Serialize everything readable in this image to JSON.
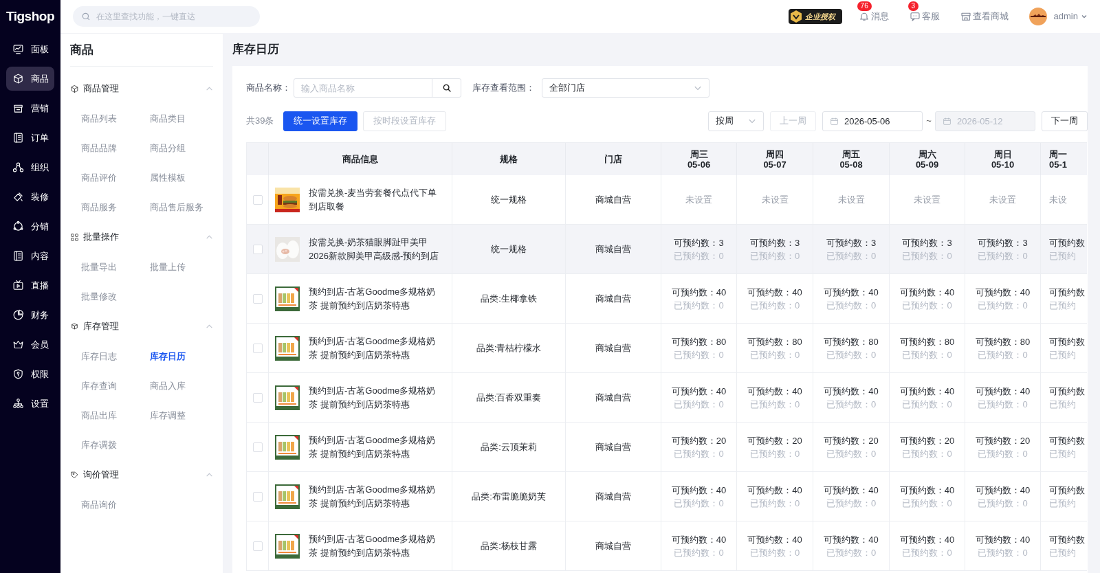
{
  "brand": "Tigshop",
  "nav": [
    {
      "label": "面板",
      "selected": false
    },
    {
      "label": "商品",
      "selected": true
    },
    {
      "label": "营销",
      "selected": false
    },
    {
      "label": "订单",
      "selected": false
    },
    {
      "label": "组织",
      "selected": false
    },
    {
      "label": "装修",
      "selected": false
    },
    {
      "label": "分销",
      "selected": false
    },
    {
      "label": "内容",
      "selected": false
    },
    {
      "label": "直播",
      "selected": false
    },
    {
      "label": "财务",
      "selected": false
    },
    {
      "label": "会员",
      "selected": false
    },
    {
      "label": "权限",
      "selected": false
    },
    {
      "label": "设置",
      "selected": false
    }
  ],
  "topbar": {
    "search": {
      "placeholder": "在这里查找功能，一键直达"
    },
    "license_badge": "企业授权",
    "actions": [
      {
        "label": "消息",
        "badge": "76"
      },
      {
        "label": "客服",
        "badge": "3"
      },
      {
        "label": "查看商城"
      }
    ],
    "user": "admin"
  },
  "sidebar": {
    "title": "商品",
    "groups": [
      {
        "title": "商品管理",
        "expanded": true,
        "items": [
          {
            "label": "商品列表",
            "selected": false
          },
          {
            "label": "商品类目",
            "selected": false
          },
          {
            "label": "商品品牌",
            "selected": false
          },
          {
            "label": "商品分组",
            "selected": false
          },
          {
            "label": "商品评价",
            "selected": false
          },
          {
            "label": "属性模板",
            "selected": false
          },
          {
            "label": "商品服务",
            "selected": false
          },
          {
            "label": "商品售后服务",
            "selected": false
          }
        ]
      },
      {
        "title": "批量操作",
        "expanded": true,
        "items": [
          {
            "label": "批量导出",
            "selected": false
          },
          {
            "label": "批量上传",
            "selected": false
          },
          {
            "label": "批量修改",
            "selected": false
          }
        ]
      },
      {
        "title": "库存管理",
        "expanded": true,
        "items": [
          {
            "label": "库存日志",
            "selected": false
          },
          {
            "label": "库存日历",
            "selected": true
          },
          {
            "label": "库存查询",
            "selected": false
          },
          {
            "label": "商品入库",
            "selected": false
          },
          {
            "label": "商品出库",
            "selected": false
          },
          {
            "label": "库存调整",
            "selected": false
          },
          {
            "label": "库存调拨",
            "selected": false
          }
        ]
      },
      {
        "title": "询价管理",
        "expanded": true,
        "items": [
          {
            "label": "商品询价",
            "selected": false
          }
        ]
      }
    ]
  },
  "page_title": "库存日历",
  "filters": {
    "name_label": "商品名称：",
    "name_placeholder": "输入商品名称",
    "scope_label": "库存查看范围：",
    "scope_value": "全部门店"
  },
  "toolbar": {
    "total": "共39条",
    "buttons": [
      {
        "label": "统一设置库存",
        "kind": "primary"
      },
      {
        "label": "按时段设置库存",
        "kind": "disabled"
      }
    ],
    "period": "按周",
    "prev": {
      "label": "上一周",
      "disabled": true
    },
    "start_date": "2026-05-06",
    "separator": "~",
    "end_date": {
      "value": "2026-05-12",
      "disabled": true
    },
    "next": {
      "label": "下一周",
      "disabled": false
    }
  },
  "table": {
    "columns": [
      "商品信息",
      "规格",
      "门店"
    ],
    "days": [
      {
        "weekday": "周三",
        "date": "05-06"
      },
      {
        "weekday": "周四",
        "date": "05-07"
      },
      {
        "weekday": "周五",
        "date": "05-08"
      },
      {
        "weekday": "周六",
        "date": "05-09"
      },
      {
        "weekday": "周日",
        "date": "05-10"
      },
      {
        "weekday": "周一",
        "date": "05-1"
      }
    ],
    "rows": [
      {
        "checked": false,
        "hovered": false,
        "name": "按需兑换-麦当劳套餐代点代下单到店取餐",
        "spec": "统一规格",
        "store": "商城自营",
        "cells": [
          {
            "kind": "unset",
            "text": "未设置"
          },
          {
            "kind": "unset",
            "text": "未设置"
          },
          {
            "kind": "unset",
            "text": "未设置"
          },
          {
            "kind": "unset",
            "text": "未设置"
          },
          {
            "kind": "unset",
            "text": "未设置"
          },
          {
            "kind": "unset",
            "text": "未设"
          }
        ]
      },
      {
        "checked": false,
        "hovered": true,
        "name": "按需兑换-奶茶猫眼脚趾甲美甲2026新款脚美甲高级感-预约到店",
        "spec": "统一规格",
        "store": "商城自营",
        "cells": [
          {
            "kind": "stock",
            "available": "可预约数：3",
            "booked": "已预约数：0"
          },
          {
            "kind": "stock",
            "available": "可预约数：3",
            "booked": "已预约数：0"
          },
          {
            "kind": "stock",
            "available": "可预约数：3",
            "booked": "已预约数：0"
          },
          {
            "kind": "stock",
            "available": "可预约数：3",
            "booked": "已预约数：0"
          },
          {
            "kind": "stock",
            "available": "可预约数：3",
            "booked": "已预约数：0"
          },
          {
            "kind": "stock",
            "available": "可预约数",
            "booked": "已预约"
          }
        ]
      },
      {
        "checked": false,
        "hovered": false,
        "name": "预约到店-古茗Goodme多规格奶茶 提前预约到店奶茶特惠",
        "spec": "品类:生椰拿铁",
        "store": "商城自营",
        "cells": [
          {
            "kind": "stock",
            "available": "可预约数：40",
            "booked": "已预约数：0"
          },
          {
            "kind": "stock",
            "available": "可预约数：40",
            "booked": "已预约数：0"
          },
          {
            "kind": "stock",
            "available": "可预约数：40",
            "booked": "已预约数：0"
          },
          {
            "kind": "stock",
            "available": "可预约数：40",
            "booked": "已预约数：0"
          },
          {
            "kind": "stock",
            "available": "可预约数：40",
            "booked": "已预约数：0"
          },
          {
            "kind": "stock",
            "available": "可预约数",
            "booked": "已预约"
          }
        ]
      },
      {
        "checked": false,
        "hovered": false,
        "name": "预约到店-古茗Goodme多规格奶茶 提前预约到店奶茶特惠",
        "spec": "品类:青桔柠檬水",
        "store": "商城自营",
        "cells": [
          {
            "kind": "stock",
            "available": "可预约数：80",
            "booked": "已预约数：0"
          },
          {
            "kind": "stock",
            "available": "可预约数：80",
            "booked": "已预约数：0"
          },
          {
            "kind": "stock",
            "available": "可预约数：80",
            "booked": "已预约数：0"
          },
          {
            "kind": "stock",
            "available": "可预约数：80",
            "booked": "已预约数：0"
          },
          {
            "kind": "stock",
            "available": "可预约数：80",
            "booked": "已预约数：0"
          },
          {
            "kind": "stock",
            "available": "可预约数",
            "booked": "已预约"
          }
        ]
      },
      {
        "checked": false,
        "hovered": false,
        "name": "预约到店-古茗Goodme多规格奶茶 提前预约到店奶茶特惠",
        "spec": "品类:百香双重奏",
        "store": "商城自营",
        "cells": [
          {
            "kind": "stock",
            "available": "可预约数：40",
            "booked": "已预约数：0"
          },
          {
            "kind": "stock",
            "available": "可预约数：40",
            "booked": "已预约数：0"
          },
          {
            "kind": "stock",
            "available": "可预约数：40",
            "booked": "已预约数：0"
          },
          {
            "kind": "stock",
            "available": "可预约数：40",
            "booked": "已预约数：0"
          },
          {
            "kind": "stock",
            "available": "可预约数：40",
            "booked": "已预约数：0"
          },
          {
            "kind": "stock",
            "available": "可预约数",
            "booked": "已预约"
          }
        ]
      },
      {
        "checked": false,
        "hovered": false,
        "name": "预约到店-古茗Goodme多规格奶茶 提前预约到店奶茶特惠",
        "spec": "品类:云顶茉莉",
        "store": "商城自营",
        "cells": [
          {
            "kind": "stock",
            "available": "可预约数：20",
            "booked": "已预约数：0"
          },
          {
            "kind": "stock",
            "available": "可预约数：20",
            "booked": "已预约数：0"
          },
          {
            "kind": "stock",
            "available": "可预约数：20",
            "booked": "已预约数：0"
          },
          {
            "kind": "stock",
            "available": "可预约数：20",
            "booked": "已预约数：0"
          },
          {
            "kind": "stock",
            "available": "可预约数：20",
            "booked": "已预约数：0"
          },
          {
            "kind": "stock",
            "available": "可预约数",
            "booked": "已预约"
          }
        ]
      },
      {
        "checked": false,
        "hovered": false,
        "name": "预约到店-古茗Goodme多规格奶茶 提前预约到店奶茶特惠",
        "spec": "品类:布雷脆脆奶芙",
        "store": "商城自营",
        "cells": [
          {
            "kind": "stock",
            "available": "可预约数：40",
            "booked": "已预约数：0"
          },
          {
            "kind": "stock",
            "available": "可预约数：40",
            "booked": "已预约数：0"
          },
          {
            "kind": "stock",
            "available": "可预约数：40",
            "booked": "已预约数：0"
          },
          {
            "kind": "stock",
            "available": "可预约数：40",
            "booked": "已预约数：0"
          },
          {
            "kind": "stock",
            "available": "可预约数：40",
            "booked": "已预约数：0"
          },
          {
            "kind": "stock",
            "available": "可预约数",
            "booked": "已预约"
          }
        ]
      },
      {
        "checked": false,
        "hovered": false,
        "name": "预约到店-古茗Goodme多规格奶茶 提前预约到店奶茶特惠",
        "spec": "品类:杨枝甘露",
        "store": "商城自营",
        "cells": [
          {
            "kind": "stock",
            "available": "可预约数：40",
            "booked": "已预约数：0"
          },
          {
            "kind": "stock",
            "available": "可预约数：40",
            "booked": "已预约数：0"
          },
          {
            "kind": "stock",
            "available": "可预约数：40",
            "booked": "已预约数：0"
          },
          {
            "kind": "stock",
            "available": "可预约数：40",
            "booked": "已预约数：0"
          },
          {
            "kind": "stock",
            "available": "可预约数：40",
            "booked": "已预约数：0"
          },
          {
            "kind": "stock",
            "available": "可预约数",
            "booked": "已预约"
          }
        ]
      }
    ]
  }
}
